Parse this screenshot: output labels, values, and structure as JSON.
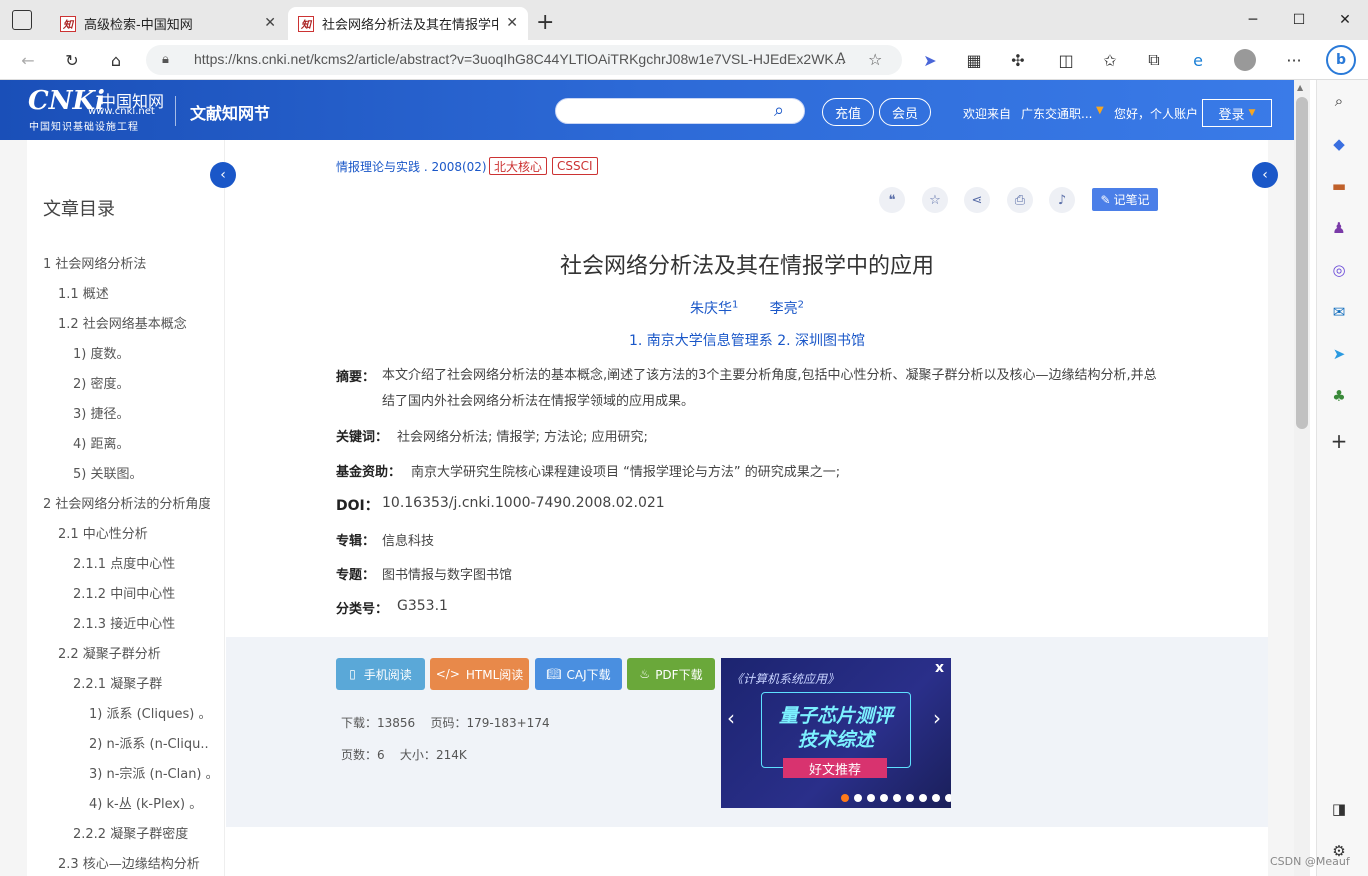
{
  "browser": {
    "tabs": [
      {
        "title": "高级检索-中国知网",
        "favicon": "知"
      },
      {
        "title": "社会网络分析法及其在情报学中的",
        "favicon": "知"
      }
    ],
    "new_tab": "+",
    "url": "https://kns.cnki.net/kcms2/article/abstract?v=3uoqIhG8C44YLTlOAiTRKgchrJ08w1e7VSL-HJEdEx2WK...",
    "reader_icon": "A",
    "menu_icon": "···"
  },
  "header": {
    "logo_main": "CNKi",
    "logo_cn": "中国知网",
    "logo_url": "www.cnki.net",
    "logo_sub": "中国知识基础设施工程",
    "site_name": "文献知网节",
    "recharge": "充值",
    "member": "会员",
    "welcome": "欢迎来自",
    "institution": "广东交通职...",
    "hello": "您好，个人账户",
    "login": "登录"
  },
  "toc": {
    "title": "文章目录",
    "items": [
      {
        "label": "1 社会网络分析法",
        "level": 0
      },
      {
        "label": "1.1 概述",
        "level": 1
      },
      {
        "label": "1.2 社会网络基本概念",
        "level": 1
      },
      {
        "label": "1) 度数。",
        "level": 2
      },
      {
        "label": "2) 密度。",
        "level": 2
      },
      {
        "label": "3) 捷径。",
        "level": 2
      },
      {
        "label": "4) 距离。",
        "level": 2
      },
      {
        "label": "5) 关联图。",
        "level": 2
      },
      {
        "label": "2 社会网络分析法的分析角度",
        "level": 0
      },
      {
        "label": "2.1 中心性分析",
        "level": 1
      },
      {
        "label": "2.1.1 点度中心性",
        "level": 2
      },
      {
        "label": "2.1.2 中间中心性",
        "level": 2
      },
      {
        "label": "2.1.3 接近中心性",
        "level": 2
      },
      {
        "label": "2.2 凝聚子群分析",
        "level": 1
      },
      {
        "label": "2.2.1 凝聚子群",
        "level": 2
      },
      {
        "label": "1) 派系 (Cliques) 。",
        "level": 3
      },
      {
        "label": "2) n-派系 (n-Cliqu...",
        "level": 3
      },
      {
        "label": "3) n-宗派 (n-Clan) 。",
        "level": 3
      },
      {
        "label": "4) k-丛 (k-Plex) 。",
        "level": 3
      },
      {
        "label": "2.2.2 凝聚子群密度",
        "level": 2
      },
      {
        "label": "2.3 核心—边缘结构分析",
        "level": 1
      }
    ]
  },
  "article": {
    "journal": "情报理论与实践 . 2008(02)",
    "tags": [
      "北大核心",
      "CSSCI"
    ],
    "note_button": "记笔记",
    "title": "社会网络分析法及其在情报学中的应用",
    "author1": "朱庆华",
    "author1_sup": "1",
    "author2": "李亮",
    "author2_sup": "2",
    "orgs": "1. 南京大学信息管理系   2. 深圳图书馆",
    "abstract_label": "摘要：",
    "abstract": "本文介绍了社会网络分析法的基本概念,阐述了该方法的3个主要分析角度,包括中心性分析、凝聚子群分析以及核心—边缘结构分析,并总结了国内外社会网络分析法在情报学领域的应用成果。",
    "keywords_label": "关键词：",
    "keywords": "社会网络分析法;  情报学;  方法论;  应用研究;",
    "fund_label": "基金资助：",
    "fund": "南京大学研究生院核心课程建设项目 “情报学理论与方法” 的研究成果之一;",
    "doi_label": "DOI：",
    "doi": "10.16353/j.cnki.1000-7490.2008.02.021",
    "album_label": "专辑：",
    "album": "信息科技",
    "topic_label": "专题：",
    "topic": "图书情报与数字图书馆",
    "class_label": "分类号：",
    "class": "G353.1"
  },
  "downloads": {
    "mobile": "手机阅读",
    "html": "HTML阅读",
    "caj": "CAJ下载",
    "pdf": "PDF下载",
    "downloads_label": "下载：",
    "downloads": "13856",
    "pages_label": "页码：",
    "pages": "179-183+174",
    "page_count_label": "页数：",
    "page_count": "6",
    "size_label": "大小：",
    "size": "214K"
  },
  "ad": {
    "journal": "《计算机系统应用》",
    "line1": "量子芯片测评",
    "line2": "技术综述",
    "badge": "好文推荐",
    "close": "x",
    "active_dot": 0,
    "dot_count": 9
  },
  "watermark": "CSDN @Meauf",
  "colors": {
    "brand": "#1a57c8",
    "tag": "#cc3333",
    "mobile": "#5aa8d8",
    "html": "#e8894a",
    "caj": "#4a8fe0",
    "pdf": "#6aa83a"
  }
}
